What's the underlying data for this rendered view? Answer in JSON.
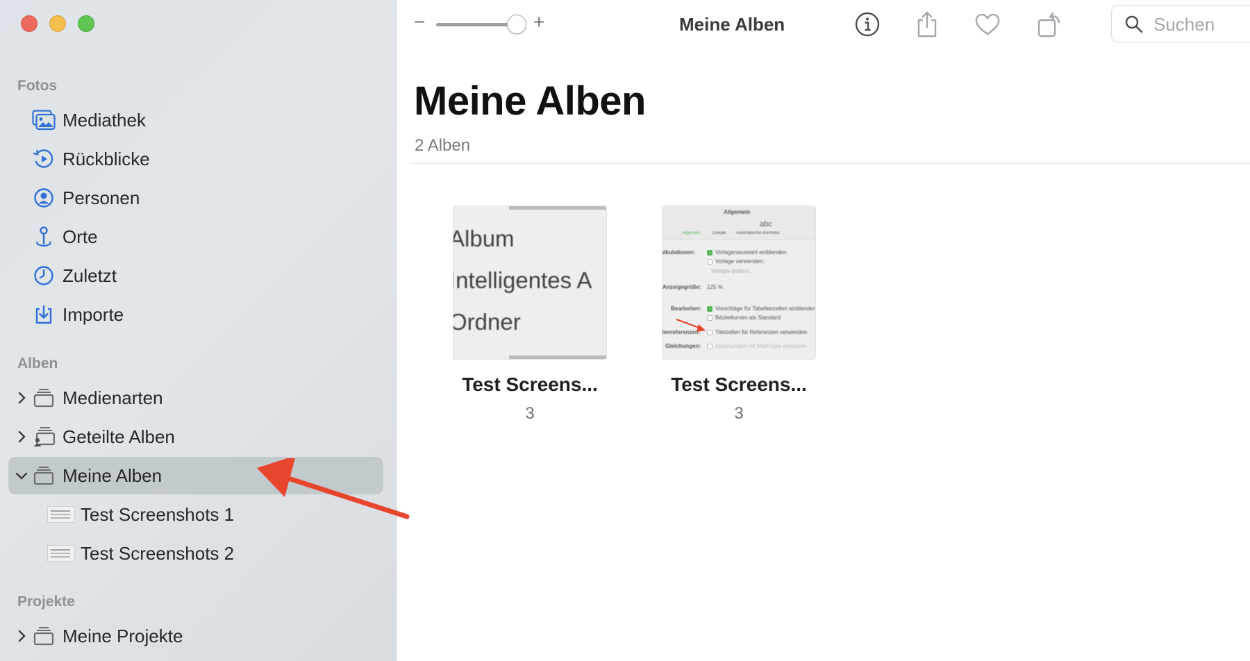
{
  "colors": {
    "accent": "#2f6fd8",
    "traffic_red": "#ed6a5e",
    "traffic_yellow": "#f5bf4f",
    "traffic_green": "#61c554",
    "annotation_arrow": "#e8452e",
    "sidebar_selected": "#c3cace"
  },
  "sidebar": {
    "sections": [
      {
        "title": "Fotos",
        "items": [
          {
            "label": "Mediathek",
            "icon": "photo-library-icon"
          },
          {
            "label": "Rückblicke",
            "icon": "memories-icon"
          },
          {
            "label": "Personen",
            "icon": "person-icon"
          },
          {
            "label": "Orte",
            "icon": "map-pin-icon"
          },
          {
            "label": "Zuletzt",
            "icon": "clock-icon"
          },
          {
            "label": "Importe",
            "icon": "import-icon"
          }
        ]
      },
      {
        "title": "Alben",
        "items": [
          {
            "label": "Medienarten",
            "icon": "album-stack-icon",
            "disclosure": "collapsed"
          },
          {
            "label": "Geteilte Alben",
            "icon": "shared-album-icon",
            "disclosure": "collapsed"
          },
          {
            "label": "Meine Alben",
            "icon": "album-stack-icon",
            "disclosure": "expanded",
            "selected": true
          }
        ],
        "children": [
          {
            "label": "Test Screenshots 1"
          },
          {
            "label": "Test Screenshots 2"
          }
        ]
      },
      {
        "title": "Projekte",
        "items": [
          {
            "label": "Meine Projekte",
            "icon": "album-stack-icon",
            "disclosure": "collapsed"
          }
        ]
      }
    ]
  },
  "toolbar": {
    "zoom_minus": "−",
    "zoom_plus": "+",
    "title": "Meine Alben",
    "search_placeholder": "Suchen",
    "zoom_level": 0.85
  },
  "main": {
    "title": "Meine Alben",
    "count_label": "2 Alben",
    "albums": [
      {
        "name": "Test Screens...",
        "count": "3",
        "cover_lines": [
          "Album",
          "Intelligentes A",
          "Ordner"
        ]
      },
      {
        "name": "Test Screens...",
        "count": "3",
        "cover_text": {
          "header": "Allgemein",
          "tabs": [
            "Allgemein",
            "Lineale",
            "Automatische Korrektur"
          ],
          "tab_icon_text": "abc",
          "rows": [
            "Kalkulationen:",
            "Vorlagenauswahl einblenden",
            "Vorlage verwenden:",
            "Vorlage ändern…",
            "Anzeigegröße:",
            "125 %",
            "Bearbeiten:",
            "Vorschläge für Tabellenzellen einblenden",
            "Bézierkurven als Standard",
            "Zellenreferenzen:",
            "Titelzellen für Referenzen verwenden",
            "Gleichungen:",
            "Gleichungen mit MathType einsetzen"
          ]
        }
      }
    ]
  }
}
